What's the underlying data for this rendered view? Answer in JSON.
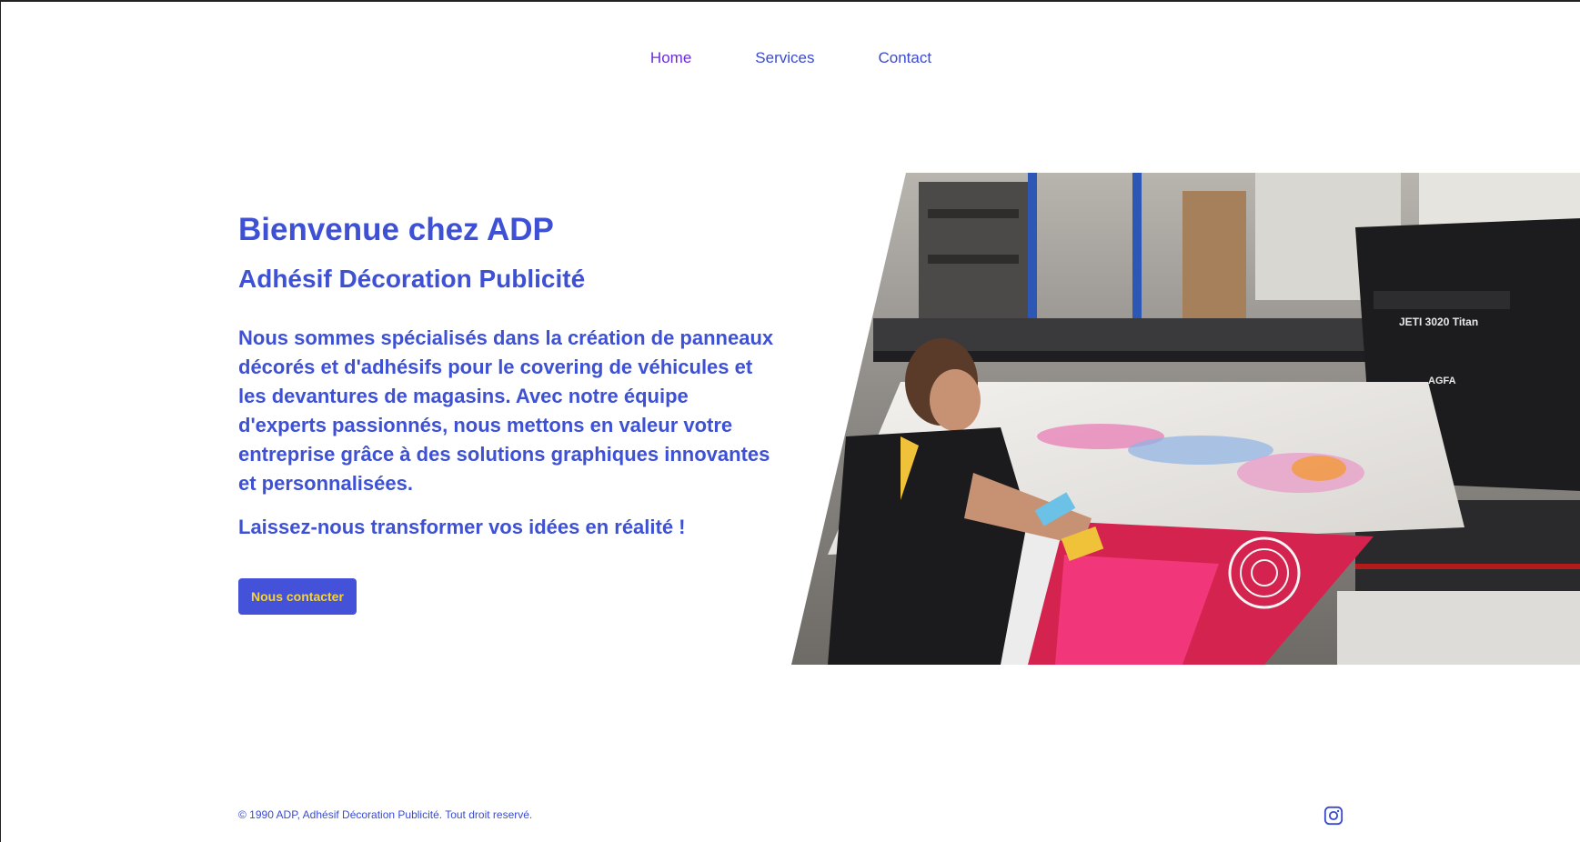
{
  "nav": {
    "items": [
      {
        "label": "Home"
      },
      {
        "label": "Services"
      },
      {
        "label": "Contact"
      }
    ]
  },
  "hero": {
    "title": "Bienvenue chez ADP",
    "subtitle": "Adhésif Décoration Publicité",
    "description": "Nous sommes spécialisés dans la création de panneaux décorés et d'adhésifs pour le covering de véhicules et les devantures de magasins. Avec notre équipe d'experts passionnés, nous mettons en valeur votre entreprise grâce à des solutions graphiques innovantes et personnalisées.",
    "slogan": "Laissez-nous transformer vos idées en réalité !",
    "cta_label": "Nous contacter",
    "image_texts": {
      "printer_model": "JETI 3020 Titan",
      "printer_brand": "AGFA"
    }
  },
  "footer": {
    "copyright": "© 1990 ADP, Adhésif Décoration Publicité. Tout droit reservé.",
    "social_icon": "instagram-icon"
  },
  "colors": {
    "primary_text": "#3e51d4",
    "nav_active": "#6a2bd6",
    "button_bg": "#4352d9",
    "button_text": "#f4d33a"
  }
}
